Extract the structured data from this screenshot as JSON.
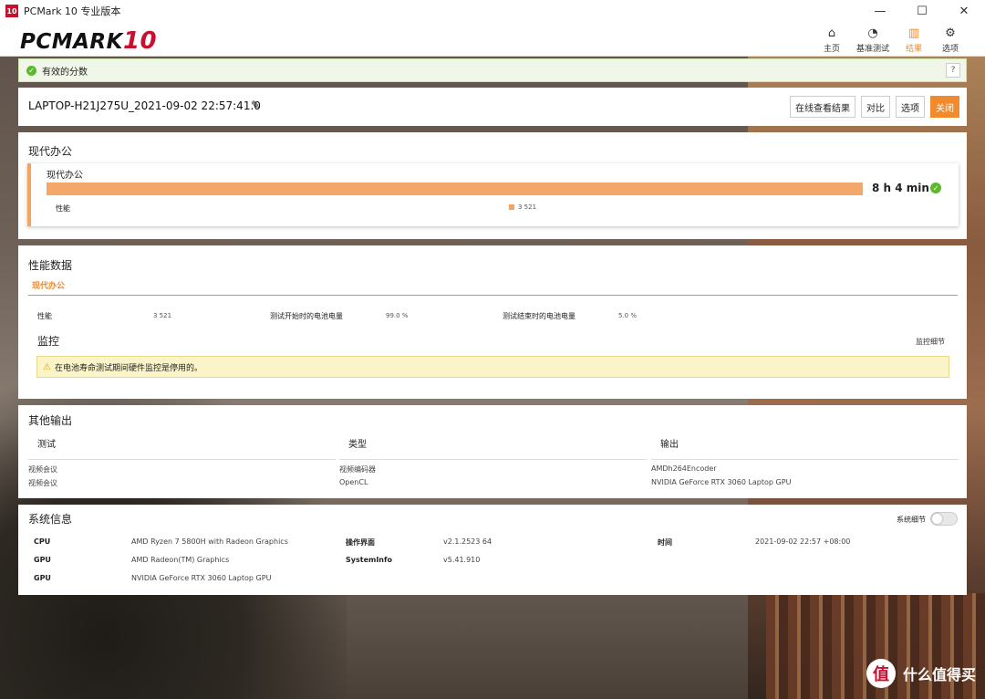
{
  "window": {
    "title": "PCMark 10 专业版本",
    "icon_text": "10"
  },
  "logo": {
    "text": "PCMARK",
    "num": "10"
  },
  "nav": [
    {
      "label": "主页",
      "icon": "home-icon",
      "glyph": "⌂"
    },
    {
      "label": "基准测试",
      "icon": "gauge-icon",
      "glyph": "◔"
    },
    {
      "label": "结果",
      "icon": "bar-chart-icon",
      "glyph": "▥"
    },
    {
      "label": "选项",
      "icon": "gear-icon",
      "glyph": "⚙"
    }
  ],
  "banner": {
    "text": "有效的分数",
    "help": "?"
  },
  "result": {
    "name": "LAPTOP-H21J275U_2021-09-02 22:57:41.0",
    "buttons": {
      "online": "在线查看结果",
      "compare": "对比",
      "options": "选项",
      "close": "关闭"
    }
  },
  "office": {
    "section_title": "现代办公",
    "card_label": "现代办公",
    "score": "8 h 4 min",
    "perf_label": "性能",
    "perf_value": "3 521"
  },
  "perf_data": {
    "title": "性能数据",
    "tab": "现代办公",
    "perf_label": "性能",
    "perf_value": "3 521",
    "start_label": "测试开始时的电池电量",
    "start_value": "99.0 %",
    "end_label": "测试结束时的电池电量",
    "end_value": "5.0 %",
    "monitor_title": "监控",
    "monitor_link": "监控细节",
    "warning": "在电池寿命测试期间硬件监控是停用的。"
  },
  "other_output": {
    "title": "其他输出",
    "headers": [
      "测试",
      "类型",
      "输出"
    ],
    "rows": [
      [
        "视频会议",
        "视频编码器",
        "AMDh264Encoder"
      ],
      [
        "视频会议",
        "OpenCL",
        "NVIDIA GeForce RTX 3060 Laptop GPU"
      ]
    ]
  },
  "sysinfo": {
    "title": "系统信息",
    "toggle_label": "系统细节",
    "cpu_label": "CPU",
    "cpu_value": "AMD Ryzen 7 5800H with Radeon Graphics",
    "gpu1_label": "GPU",
    "gpu1_value": "AMD Radeon(TM) Graphics",
    "gpu2_label": "GPU",
    "gpu2_value": "NVIDIA GeForce RTX 3060 Laptop GPU",
    "ui_label": "操作界面",
    "ui_value": "v2.1.2523 64",
    "si_label": "SystemInfo",
    "si_value": "v5.41.910",
    "time_label": "时间",
    "time_value": "2021-09-02 22:57 +08:00"
  },
  "watermark": {
    "logo": "值",
    "text": "什么值得买"
  }
}
